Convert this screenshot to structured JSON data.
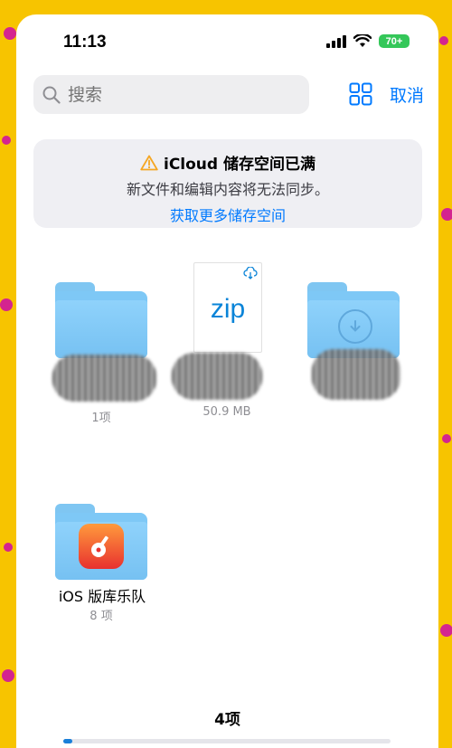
{
  "status": {
    "time": "11:13",
    "battery": "70+"
  },
  "search": {
    "placeholder": "搜索",
    "cancel_label": "取消"
  },
  "banner": {
    "title": "iCloud 储存空间已满",
    "message": "新文件和编辑内容将无法同步。",
    "link": "获取更多储存空间"
  },
  "items": [
    {
      "type": "folder",
      "name": "",
      "detail": "1项"
    },
    {
      "type": "file",
      "icon_text": "zip",
      "name": "",
      "detail": "50.9 MB"
    },
    {
      "type": "folder-download",
      "name": "",
      "detail": ""
    },
    {
      "type": "folder-app",
      "name": "iOS 版库乐队",
      "detail": "8 项"
    }
  ],
  "footer": {
    "count": "4项"
  },
  "colors": {
    "accent": "#007aff",
    "folder": "#7ec8f6",
    "battery": "#34c759",
    "warning": "#f5a623"
  }
}
